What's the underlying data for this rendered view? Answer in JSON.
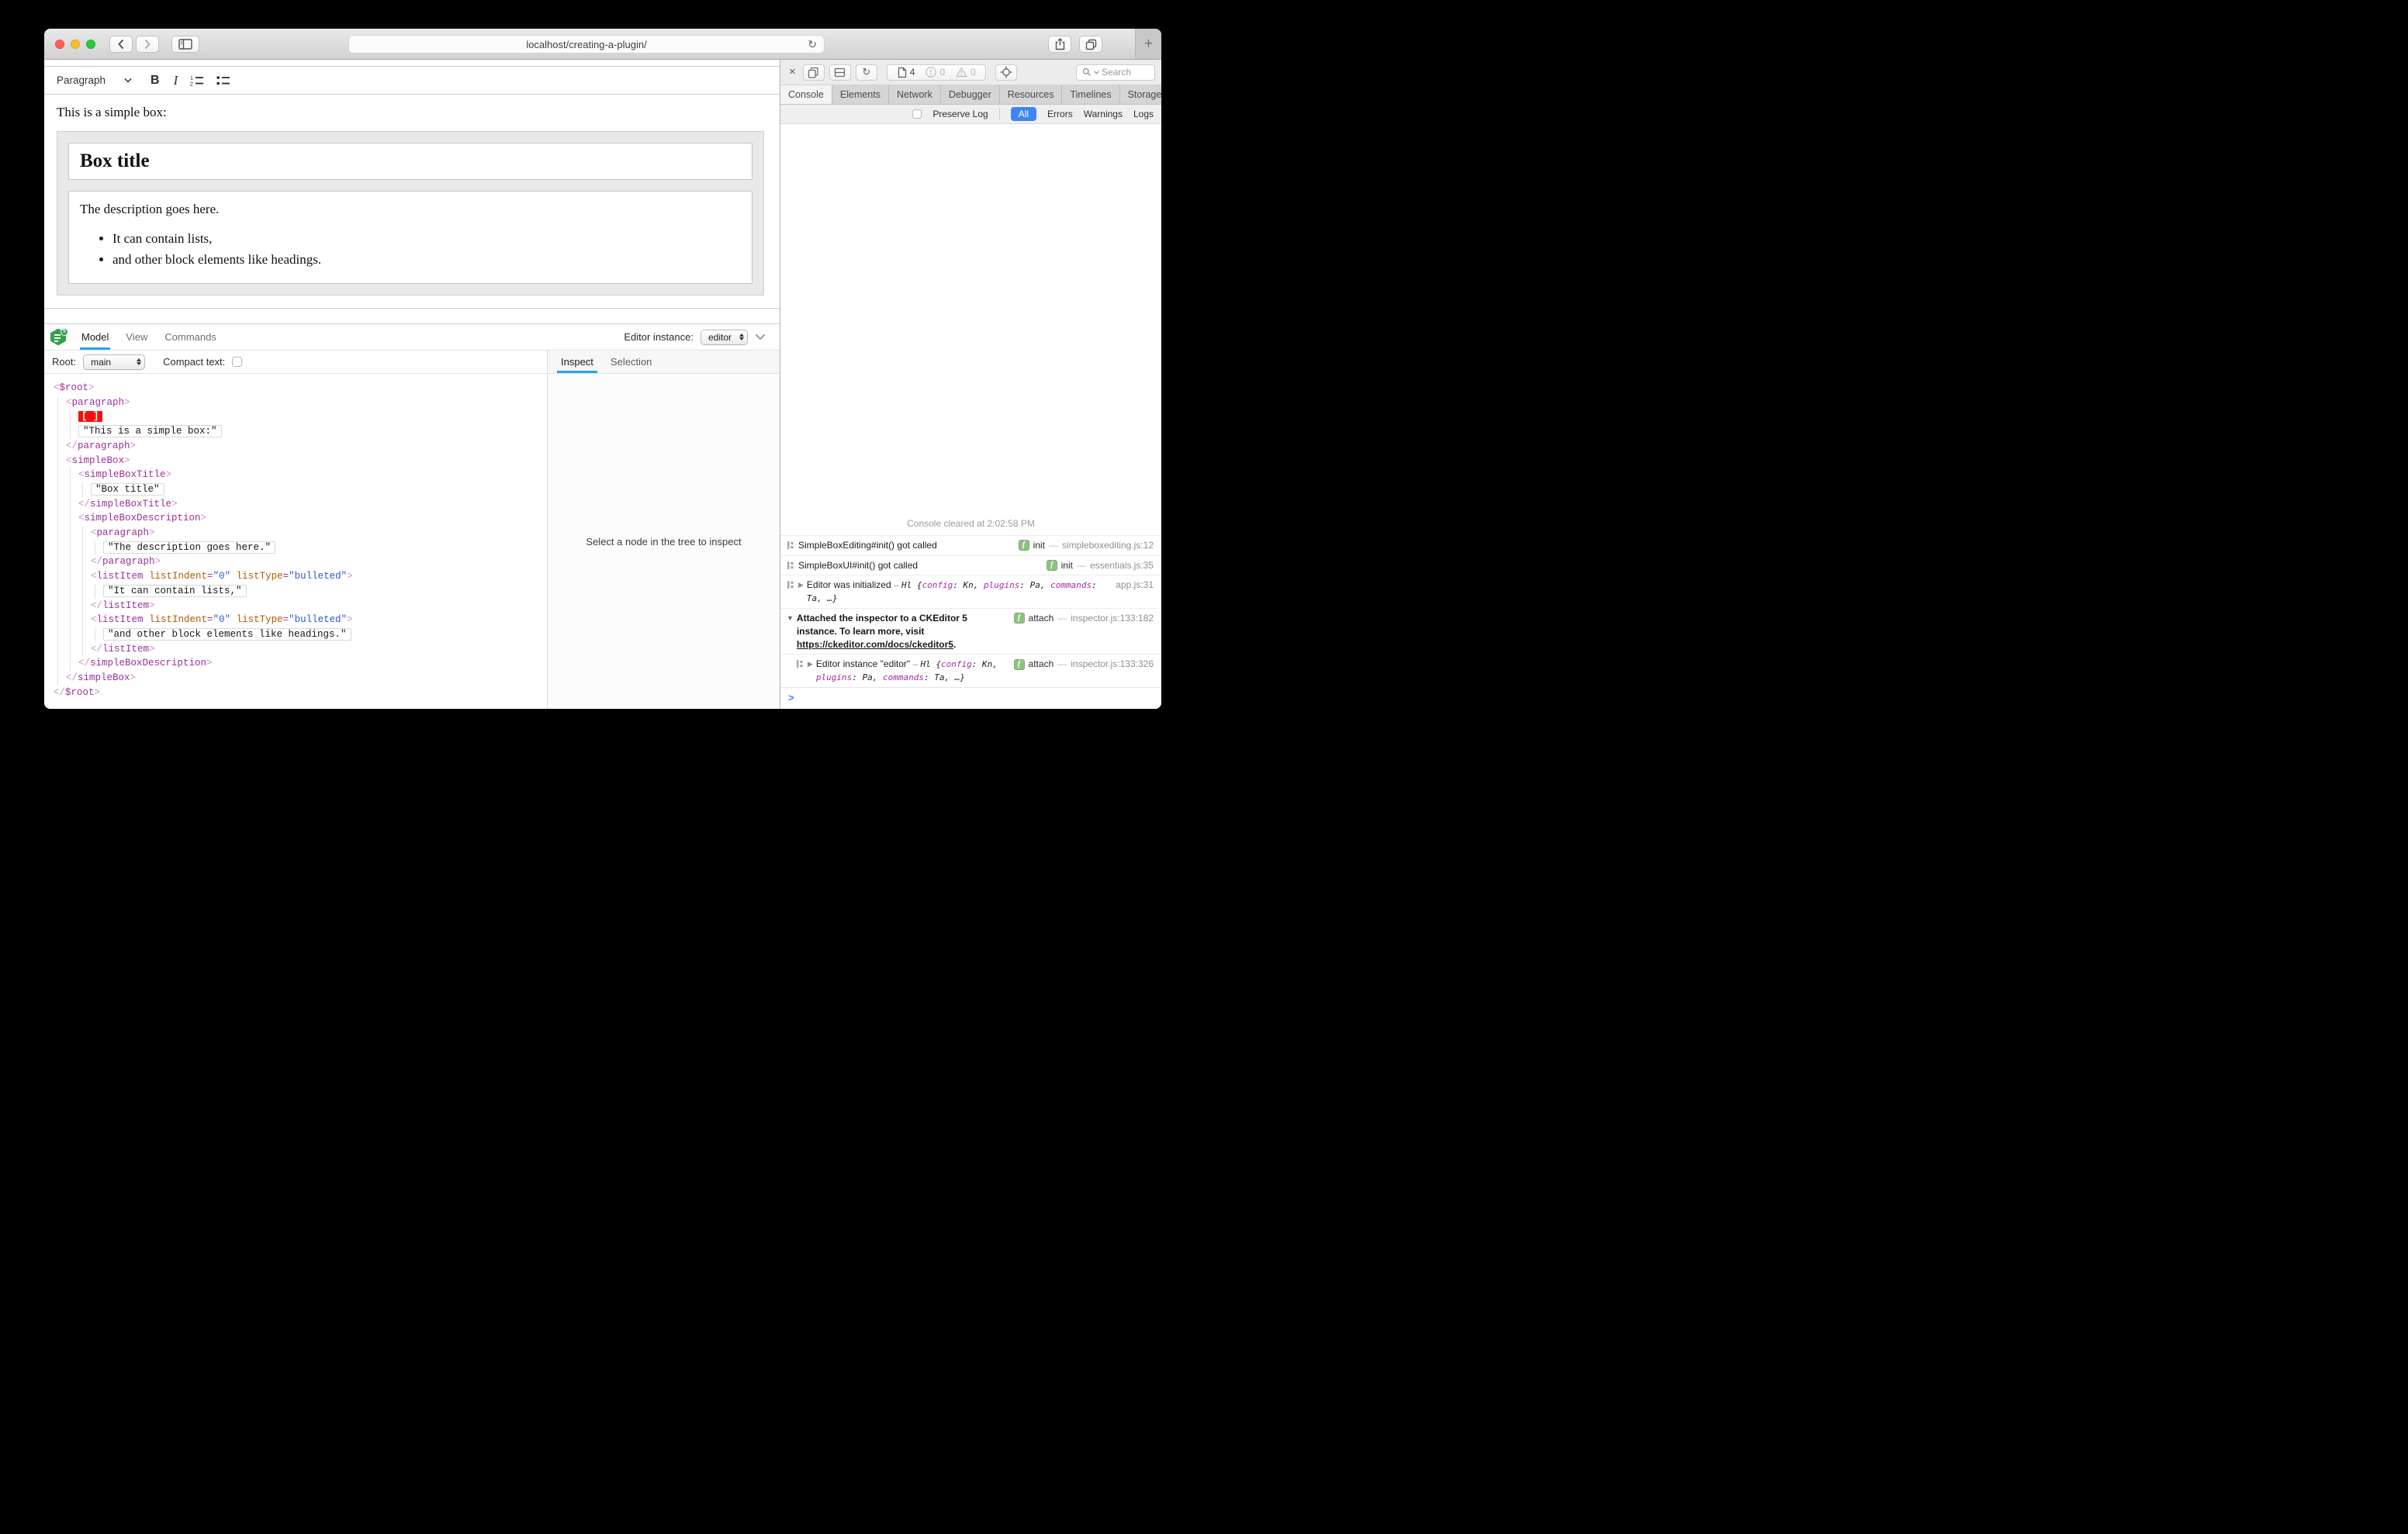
{
  "browser": {
    "url": "localhost/creating-a-plugin/",
    "reload_glyph": "↻",
    "new_tab_glyph": "+"
  },
  "editor": {
    "toolbar": {
      "heading_dropdown": "Paragraph",
      "bold_label": "B",
      "italic_label": "I"
    },
    "content": {
      "intro": "This is a simple box:",
      "box_title": "Box title",
      "description": "The description goes here.",
      "list": [
        "It can contain lists,",
        "and other block elements like headings."
      ]
    }
  },
  "inspector": {
    "tabs": [
      "Model",
      "View",
      "Commands"
    ],
    "active_tab": "Model",
    "editor_instance_label": "Editor instance:",
    "editor_instance_value": "editor",
    "root_label": "Root:",
    "root_value": "main",
    "compact_text_label": "Compact text:",
    "side_tabs": [
      "Inspect",
      "Selection"
    ],
    "active_side_tab": "Inspect",
    "empty_message": "Select a node in the tree to inspect",
    "tree": {
      "tag": "$root",
      "children": [
        {
          "tag": "paragraph",
          "children": [
            {
              "marker": "[ ]"
            },
            {
              "text": "\"This is a simple box:\""
            }
          ]
        },
        {
          "tag": "simpleBox",
          "children": [
            {
              "tag": "simpleBoxTitle",
              "children": [
                {
                  "text": "\"Box title\""
                }
              ]
            },
            {
              "tag": "simpleBoxDescription",
              "children": [
                {
                  "tag": "paragraph",
                  "children": [
                    {
                      "text": "\"The description goes here.\""
                    }
                  ]
                },
                {
                  "tag": "listItem",
                  "attrs": [
                    [
                      "listIndent",
                      "0"
                    ],
                    [
                      "listType",
                      "bulleted"
                    ]
                  ],
                  "children": [
                    {
                      "text": "\"It can contain lists,\""
                    }
                  ]
                },
                {
                  "tag": "listItem",
                  "attrs": [
                    [
                      "listIndent",
                      "0"
                    ],
                    [
                      "listType",
                      "bulleted"
                    ]
                  ],
                  "children": [
                    {
                      "text": "\"and other block elements like headings.\""
                    }
                  ]
                }
              ]
            }
          ]
        }
      ]
    }
  },
  "devtools": {
    "toolbar": {
      "close_glyph": "×",
      "resource_count": "4",
      "error_count": "0",
      "warning_count": "0",
      "search_placeholder": "Search"
    },
    "tabs": [
      "Console",
      "Elements",
      "Network",
      "Debugger",
      "Resources",
      "Timelines",
      "Storage"
    ],
    "active_tab": "Console",
    "overflow_glyph": "»",
    "add_glyph": "+",
    "filter": {
      "preserve_log_label": "Preserve Log",
      "scopes": [
        "All",
        "Errors",
        "Warnings",
        "Logs"
      ],
      "active_scope": "All"
    },
    "console": {
      "cleared_message": "Console cleared at 2:02:58 PM",
      "prompt_glyph": ">",
      "rows": [
        {
          "icon": true,
          "parts": [
            {
              "t": "SimpleBoxEditing#init() got called"
            }
          ],
          "badge": "init",
          "location": "simpleboxediting.js:12"
        },
        {
          "icon": true,
          "parts": [
            {
              "t": "SimpleBoxUI#init() got called"
            }
          ],
          "badge": "init",
          "location": "essentials.js:35"
        },
        {
          "icon": true,
          "expand": "closed",
          "parts": [
            {
              "t": "Editor was initialized"
            },
            {
              "t": " – ",
              "c": "sep"
            },
            {
              "t": "Hl ",
              "c": "cls"
            },
            {
              "t": "{",
              "c": "obj"
            },
            {
              "t": "config",
              "c": "key"
            },
            {
              "t": ": ",
              "c": "obj"
            },
            {
              "t": "Kn",
              "c": "cls"
            },
            {
              "t": ", ",
              "c": "obj"
            },
            {
              "t": "plugins",
              "c": "key"
            },
            {
              "t": ": ",
              "c": "obj"
            },
            {
              "t": "Pa",
              "c": "cls"
            },
            {
              "t": ", ",
              "c": "obj"
            },
            {
              "t": "commands",
              "c": "key"
            },
            {
              "t": ": ",
              "c": "obj"
            },
            {
              "t": "Ta",
              "c": "cls"
            },
            {
              "t": ", …}",
              "c": "obj"
            }
          ],
          "badge": null,
          "location": "app.js:31"
        },
        {
          "expand": "open",
          "bold": true,
          "parts": [
            {
              "t": "Attached the inspector to a CKEditor 5 instance. To learn more, visit "
            },
            {
              "t": "https://ckeditor.com/docs/ckeditor5",
              "c": "link"
            },
            {
              "t": "."
            }
          ],
          "badge": "attach",
          "location": "inspector.js:133:182"
        },
        {
          "icon": true,
          "expand": "closed",
          "indent": true,
          "parts": [
            {
              "t": "Editor instance \"editor\""
            },
            {
              "t": " – ",
              "c": "sep"
            },
            {
              "t": "Hl ",
              "c": "cls"
            },
            {
              "t": "{",
              "c": "obj"
            },
            {
              "t": "config",
              "c": "key"
            },
            {
              "t": ": ",
              "c": "obj"
            },
            {
              "t": "Kn",
              "c": "cls"
            },
            {
              "t": ", ",
              "c": "obj"
            },
            {
              "t": "plugins",
              "c": "key"
            },
            {
              "t": ": ",
              "c": "obj"
            },
            {
              "t": "Pa",
              "c": "cls"
            },
            {
              "t": ", ",
              "c": "obj"
            },
            {
              "t": "commands",
              "c": "key"
            },
            {
              "t": ": ",
              "c": "obj"
            },
            {
              "t": "Ta",
              "c": "cls"
            },
            {
              "t": ", …}",
              "c": "obj"
            }
          ],
          "badge": "attach",
          "location": "inspector.js:133:326"
        }
      ]
    }
  },
  "colors": {
    "inspector_accent_blue": "#29a3f1",
    "filter_blue": "#3e86f7",
    "badge_green": "#8fc184",
    "selection_marker_red": "#f50f0f",
    "tag_purple": "#9b2f9b",
    "attribute_orange": "#b25900",
    "attribute_value_blue": "#2f55cf"
  }
}
